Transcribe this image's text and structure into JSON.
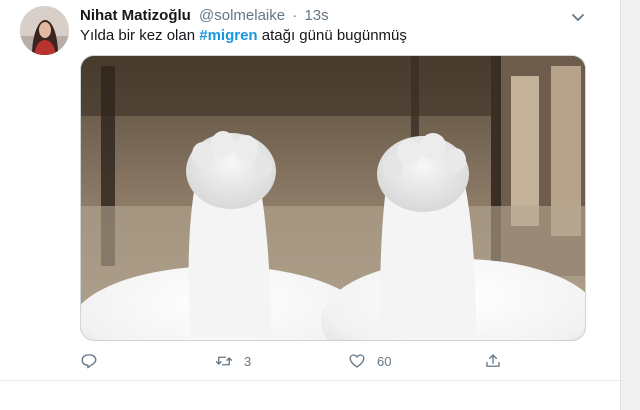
{
  "tweet": {
    "author_name": "Nihat Matizoğlu",
    "handle": "@solmelaike",
    "separator": "·",
    "timestamp": "13s",
    "text_before": "Yılda bir kez olan ",
    "hashtag": "#migren",
    "text_after": " atağı günü bugünmüş",
    "media": {
      "alt": "cat paws photo"
    }
  },
  "actions": {
    "reply": {
      "icon": "reply-icon",
      "count": ""
    },
    "retweet": {
      "icon": "retweet-icon",
      "count": "3"
    },
    "like": {
      "icon": "heart-icon",
      "count": "60"
    },
    "share": {
      "icon": "share-icon"
    }
  },
  "colors": {
    "hashtag": "#1b95e0",
    "secondary_text": "#657786",
    "border": "#ccd6dd"
  }
}
